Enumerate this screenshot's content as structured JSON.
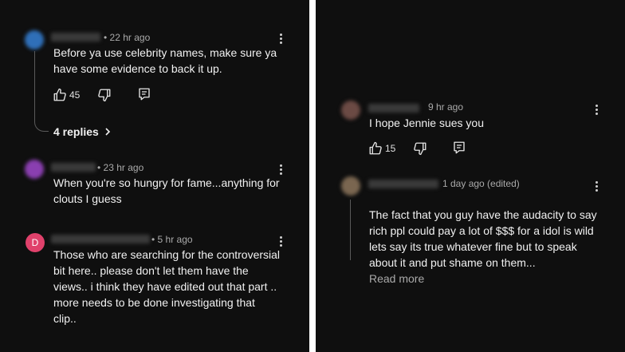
{
  "left": {
    "comments": [
      {
        "time": "• 22 hr ago",
        "text": "Before ya use celebrity names, make sure ya\nhave some evidence to back it up.",
        "likes": "45",
        "replies_label": "4 replies",
        "avatar_color": "#2f6fb8"
      },
      {
        "time": "• 23 hr ago",
        "text": "When you're so hungry for fame...anything for\nclouts I guess",
        "avatar_color": "#8a3fb0"
      },
      {
        "time": "• 5 hr ago",
        "text": "Those who are searching for the controversial\nbit here.. please don't let them have the\nviews.. i think they have edited out that part ..\nmore needs to be done investigating that\nclip..",
        "avatar_letter": "D",
        "avatar_color": "#e0416b"
      }
    ]
  },
  "right": {
    "comments": [
      {
        "time": "9 hr ago",
        "text": "I hope Jennie sues you",
        "likes": "15",
        "avatar_color": "#6b4a44"
      },
      {
        "time": "1 day ago (edited)",
        "text": "The fact that you guy have the audacity to say\nrich ppl could pay a lot of $$$ for a idol is wild\nlets say its true whatever fine but to speak\nabout it and put shame on them...",
        "read_more": "Read more",
        "avatar_color": "#7a6650"
      }
    ]
  },
  "colors": {
    "background": "#0f0f0f",
    "text": "#f1f1f1",
    "meta": "#aaaaaa",
    "separator": "#ffffff"
  },
  "icons": [
    "thumbs-up-icon",
    "thumbs-down-icon",
    "reply-icon",
    "more-vert-icon",
    "chevron-right-icon"
  ]
}
